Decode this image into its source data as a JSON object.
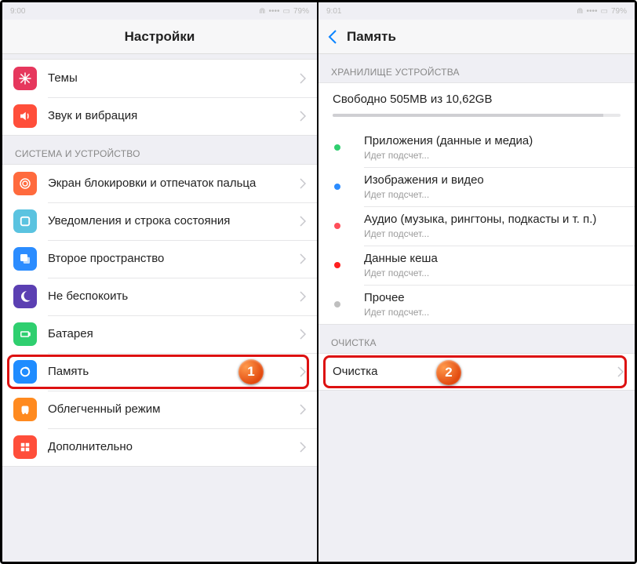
{
  "status": {
    "time_left": "9:00",
    "time_right": "9:01",
    "battery": "79%",
    "signal": "••••"
  },
  "left": {
    "header_title": "Настройки",
    "group1": [
      {
        "label": "Темы",
        "icon": "themes",
        "color": "#e6375d"
      },
      {
        "label": "Звук и вибрация",
        "icon": "sound",
        "color": "#ff4e3a"
      }
    ],
    "section_system": "СИСТЕМА И УСТРОЙСТВО",
    "group2": [
      {
        "label": "Экран блокировки и отпечаток пальца",
        "icon": "fingerprint",
        "color": "#ff6a3d"
      },
      {
        "label": "Уведомления и строка состояния",
        "icon": "notify",
        "color": "#5ac3e0"
      },
      {
        "label": "Второе пространство",
        "icon": "second",
        "color": "#2b8cff"
      },
      {
        "label": "Не беспокоить",
        "icon": "dnd",
        "color": "#5b3fb2"
      },
      {
        "label": "Батарея",
        "icon": "battery",
        "color": "#2fcf6f"
      },
      {
        "label": "Память",
        "icon": "storage",
        "color": "#1f8cff",
        "highlight": true,
        "badge": "1"
      },
      {
        "label": "Облегченный режим",
        "icon": "lite",
        "color": "#ff8a1f"
      },
      {
        "label": "Дополнительно",
        "icon": "more",
        "color": "#ff4e3a"
      }
    ]
  },
  "right": {
    "header_title": "Память",
    "section_storage": "ХРАНИЛИЩЕ УСТРОЙСТВА",
    "storage_free": "Свободно 505MB из 10,62GB",
    "storage_fill_pct": 94,
    "categories": [
      {
        "dot": "#2fcf6f",
        "title": "Приложения (данные и медиа)",
        "sub": "Идет подсчет..."
      },
      {
        "dot": "#2b8cff",
        "title": "Изображения и видео",
        "sub": "Идет подсчет..."
      },
      {
        "dot": "#ff4e5a",
        "title": "Аудио (музыка, рингтоны, подкасты и т. п.)",
        "sub": "Идет подсчет..."
      },
      {
        "dot": "#ff1f1f",
        "title": "Данные кеша",
        "sub": "Идет подсчет..."
      },
      {
        "dot": "#bfbfbf",
        "title": "Прочее",
        "sub": "Идет подсчет..."
      }
    ],
    "section_cleanup": "ОЧИСТКА",
    "cleanup_label": "Очистка",
    "cleanup_badge": "2"
  }
}
